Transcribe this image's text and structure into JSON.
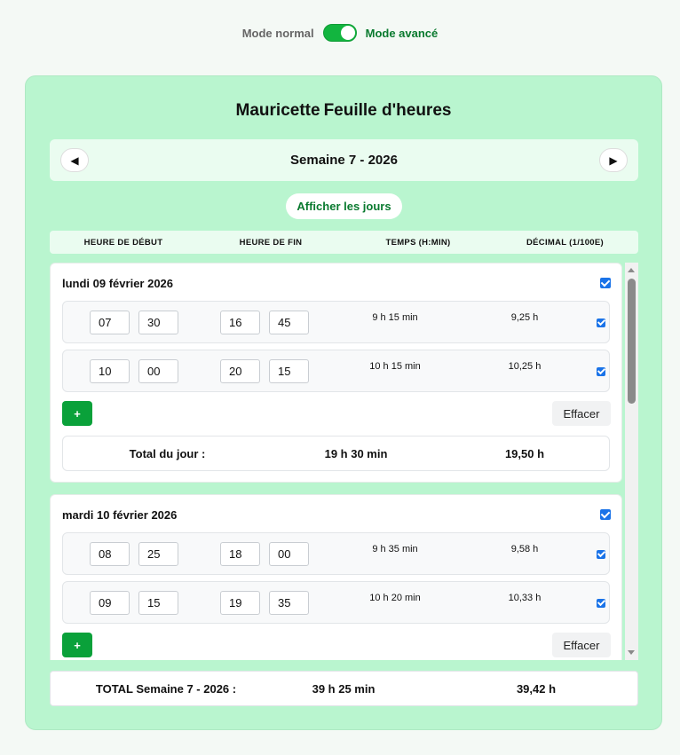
{
  "mode": {
    "normal_label": "Mode normal",
    "advanced_label": "Mode avancé",
    "advanced_enabled": true
  },
  "header": {
    "name": "Mauricette",
    "title": "Feuille d'heures"
  },
  "week_nav": {
    "prev_icon": "triangle-left-icon",
    "prev_glyph": "◀",
    "label": "Semaine 7 - 2026",
    "next_icon": "triangle-right-icon",
    "next_glyph": "▶"
  },
  "show_days_label": "Afficher les jours",
  "columns": {
    "start": "HEURE DE DÉBUT",
    "end": "HEURE DE FIN",
    "time": "TEMPS (H:MIN)",
    "decimal": "DÉCIMAL (1/100E)"
  },
  "days": [
    {
      "title": "lundi 09 février 2026",
      "checked": true,
      "entries": [
        {
          "start_h": "07",
          "start_m": "30",
          "end_h": "16",
          "end_m": "45",
          "time": "9 h 15 min",
          "decimal": "9,25 h",
          "checked": true
        },
        {
          "start_h": "10",
          "start_m": "00",
          "end_h": "20",
          "end_m": "15",
          "time": "10 h 15 min",
          "decimal": "10,25 h",
          "checked": true
        }
      ],
      "add_label": "+",
      "clear_label": "Effacer",
      "total_label": "Total du jour :",
      "total_time": "19 h 30 min",
      "total_decimal": "19,50 h"
    },
    {
      "title": "mardi 10 février 2026",
      "checked": true,
      "entries": [
        {
          "start_h": "08",
          "start_m": "25",
          "end_h": "18",
          "end_m": "00",
          "time": "9 h 35 min",
          "decimal": "9,58 h",
          "checked": true
        },
        {
          "start_h": "09",
          "start_m": "15",
          "end_h": "19",
          "end_m": "35",
          "time": "10 h 20 min",
          "decimal": "10,33 h",
          "checked": true
        }
      ],
      "add_label": "+",
      "clear_label": "Effacer"
    }
  ],
  "week_total": {
    "label": "TOTAL Semaine 7 - 2026 :",
    "time": "39 h 25 min",
    "decimal": "39,42 h"
  },
  "colors": {
    "accent": "#0aa13a",
    "card_bg": "#b9f5cf",
    "checkbox": "#1a73e8"
  }
}
